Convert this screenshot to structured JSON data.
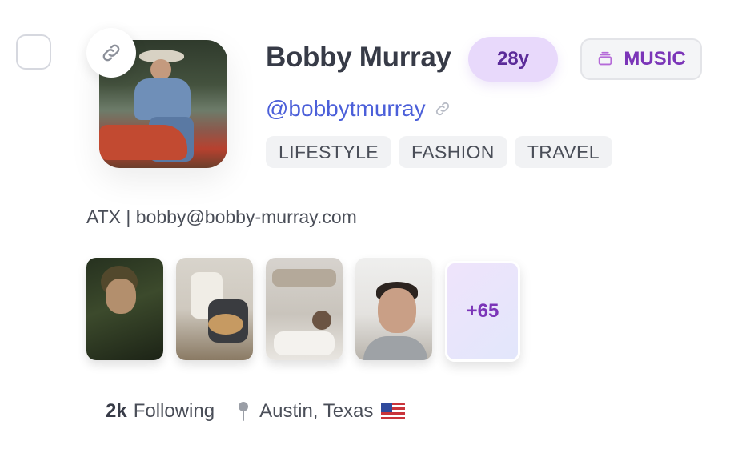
{
  "profile": {
    "name": "Bobby Murray",
    "age": "28y",
    "category": "MUSIC",
    "handle": "@bobbytmurray",
    "tags": [
      "LIFESTYLE",
      "FASHION",
      "TRAVEL"
    ],
    "bio": "ATX | bobby@bobby-murray.com"
  },
  "media": {
    "more_count": "+65"
  },
  "stats": {
    "following_count": "2k",
    "following_label": "Following",
    "location": "Austin, Texas"
  },
  "icons": {
    "link": "link-icon",
    "handle_link": "link-icon",
    "category": "stack-icon",
    "location": "pin-icon",
    "flag": "us-flag-icon"
  },
  "colors": {
    "age_pill_bg": "#e8d9fb",
    "age_pill_text": "#5b2b99",
    "accent_purple": "#7b35b8",
    "handle_blue": "#4b5fd9"
  }
}
